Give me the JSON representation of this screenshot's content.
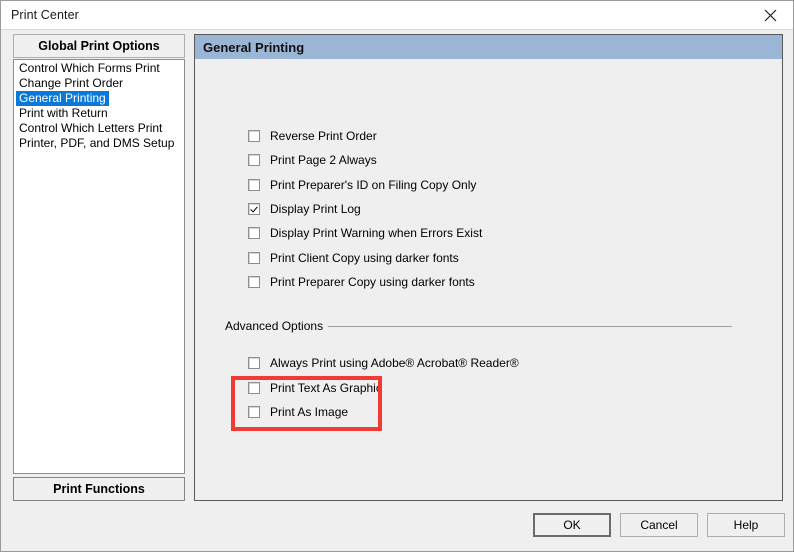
{
  "window": {
    "title": "Print Center",
    "close_icon": "close-icon"
  },
  "sidebar": {
    "header_label": "Global Print Options",
    "items": [
      {
        "label": "Control Which Forms Print",
        "selected": false
      },
      {
        "label": "Change Print Order",
        "selected": false
      },
      {
        "label": "General Printing",
        "selected": true
      },
      {
        "label": "Print with Return",
        "selected": false
      },
      {
        "label": "Control Which Letters Print",
        "selected": false
      },
      {
        "label": "Printer, PDF, and DMS Setup",
        "selected": false
      }
    ],
    "print_functions_label": "Print Functions"
  },
  "panel": {
    "header_title": "General Printing",
    "header_color": "#9bb6d4",
    "options": [
      {
        "label": "Reverse Print Order",
        "checked": false
      },
      {
        "label": "Print Page 2 Always",
        "checked": false
      },
      {
        "label": "Print Preparer's ID on Filing Copy Only",
        "checked": false
      },
      {
        "label": "Display Print Log",
        "checked": true
      },
      {
        "label": "Display Print Warning when Errors Exist",
        "checked": false
      },
      {
        "label": "Print Client Copy using darker fonts",
        "checked": false
      },
      {
        "label": "Print Preparer Copy using darker fonts",
        "checked": false
      }
    ],
    "advanced": {
      "group_label": "Advanced Options",
      "options": [
        {
          "label": "Always Print using Adobe® Acrobat® Reader®",
          "checked": false
        },
        {
          "label": "Print Text As Graphic",
          "checked": false
        },
        {
          "label": "Print As Image",
          "checked": false
        }
      ]
    }
  },
  "annotation": {
    "color": "#ef3b33"
  },
  "buttons": {
    "ok": "OK",
    "cancel": "Cancel",
    "help": "Help"
  }
}
